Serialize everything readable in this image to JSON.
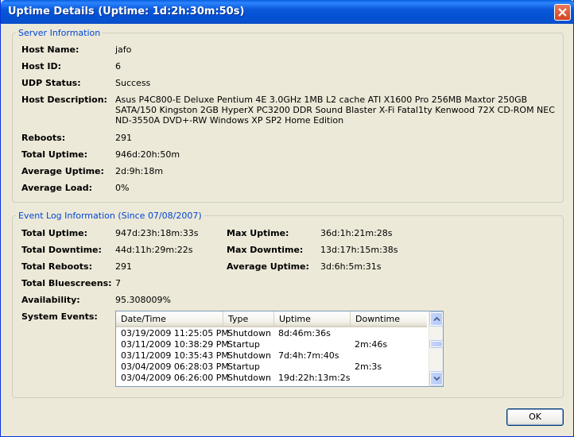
{
  "window": {
    "title": "Uptime Details (Uptime: 1d:2h:30m:50s)",
    "close_icon": "close-icon"
  },
  "server_info": {
    "legend": "Server Information",
    "host_name_label": "Host Name:",
    "host_name": "jafo",
    "host_id_label": "Host ID:",
    "host_id": "6",
    "udp_status_label": "UDP Status:",
    "udp_status": "Success",
    "host_description_label": "Host Description:",
    "host_description": "Asus P4C800-E Deluxe Pentium 4E 3.0GHz 1MB L2 cache ATI X1600 Pro 256MB Maxtor 250GB SATA/150 Kingston 2GB HyperX PC3200 DDR Sound Blaster X-Fi Fatal1ty Kenwood 72X CD-ROM NEC ND-3550A DVD+-RW Windows XP SP2 Home Edition",
    "reboots_label": "Reboots:",
    "reboots": "291",
    "total_uptime_label": "Total Uptime:",
    "total_uptime": "946d:20h:50m",
    "average_uptime_label": "Average Uptime:",
    "average_uptime": "2d:9h:18m",
    "average_load_label": "Average Load:",
    "average_load": "0%"
  },
  "event_log": {
    "legend": "Event Log Information (Since 07/08/2007)",
    "total_uptime_label": "Total Uptime:",
    "total_uptime": "947d:23h:18m:33s",
    "total_downtime_label": "Total Downtime:",
    "total_downtime": "44d:11h:29m:22s",
    "total_reboots_label": "Total Reboots:",
    "total_reboots": "291",
    "total_bluescreens_label": "Total Bluescreens:",
    "total_bluescreens": "7",
    "availability_label": "Availability:",
    "availability": "95.308009%",
    "max_uptime_label": "Max Uptime:",
    "max_uptime": "36d:1h:21m:28s",
    "max_downtime_label": "Max Downtime:",
    "max_downtime": "13d:17h:15m:38s",
    "average_uptime_label": "Average Uptime:",
    "average_uptime": "3d:6h:5m:31s",
    "system_events_label": "System Events:",
    "columns": [
      "Date/Time",
      "Type",
      "Uptime",
      "Downtime"
    ],
    "rows": [
      {
        "datetime": "03/19/2009 11:25:05 PM",
        "type": "Shutdown",
        "uptime": "8d:46m:36s",
        "downtime": ""
      },
      {
        "datetime": "03/11/2009 10:38:29 PM",
        "type": "Startup",
        "uptime": "",
        "downtime": "2m:46s"
      },
      {
        "datetime": "03/11/2009 10:35:43 PM",
        "type": "Shutdown",
        "uptime": "7d:4h:7m:40s",
        "downtime": ""
      },
      {
        "datetime": "03/04/2009 06:28:03 PM",
        "type": "Startup",
        "uptime": "",
        "downtime": "2m:3s"
      },
      {
        "datetime": "03/04/2009 06:26:00 PM",
        "type": "Shutdown",
        "uptime": "19d:22h:13m:2s",
        "downtime": ""
      }
    ],
    "scroll_position": 0.38
  },
  "buttons": {
    "ok_label": "OK"
  }
}
